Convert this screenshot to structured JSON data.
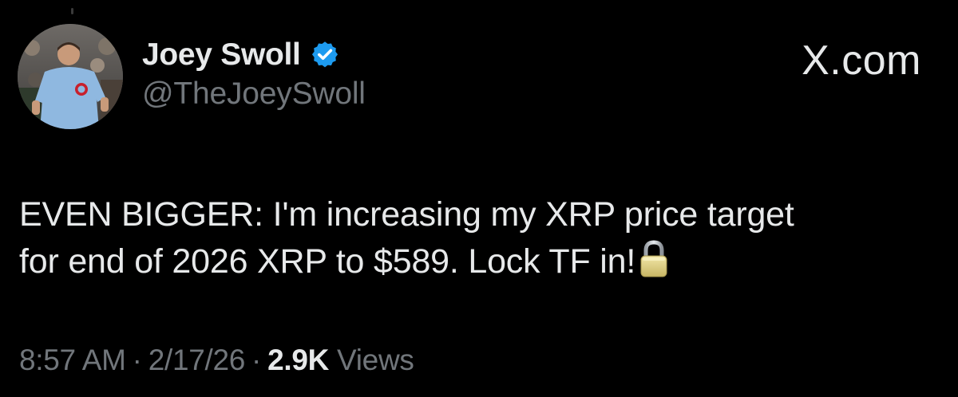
{
  "author": {
    "display_name": "Joey Swoll",
    "handle": "@TheJoeySwoll",
    "verified": true,
    "avatar_icon": "avatar-photo"
  },
  "brand": {
    "logo_text": "X.com"
  },
  "tweet": {
    "lines": [
      "EVEN BIGGER: I'm increasing my XRP price target",
      "for end of 2026 XRP to $589. Lock TF in!"
    ],
    "emoji_icon": "lock-icon"
  },
  "meta": {
    "time": "8:57 AM",
    "separator": "·",
    "date": "2/17/26",
    "views_count": "2.9K",
    "views_label": "Views"
  },
  "colors": {
    "background": "#000000",
    "primary_text": "#e7e9ea",
    "secondary_text": "#71767b",
    "verified_blue": "#1d9bf0"
  }
}
